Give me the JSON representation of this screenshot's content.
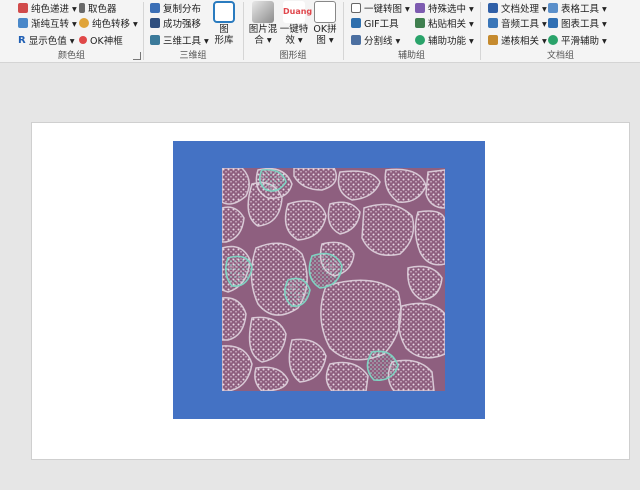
{
  "ribbon": {
    "color_group": {
      "label": "颜色组",
      "items": [
        "纯色递进 ▾",
        "渐纯互转 ▾",
        "显示色值 ▾",
        "取色器",
        "纯色转移 ▾",
        "OK神框"
      ],
      "icons": [
        "paint-bucket-icon",
        "gradient-swap-icon",
        "color-value-icon",
        "eyedropper-icon",
        "color-transfer-icon",
        "ok-frame-icon"
      ]
    },
    "3d_group": {
      "label": "三维组",
      "items": [
        "复制分布",
        "成功强移",
        "三维工具 ▾"
      ],
      "big_label": [
        "图",
        "形库"
      ],
      "icons": [
        "copy-distribute-icon",
        "layer-move-icon",
        "cube-icon",
        "shape-library-icon"
      ]
    },
    "shape_group": {
      "label": "图形组",
      "buttons": [
        {
          "lines": [
            "图片混",
            "合 ▾"
          ],
          "icon": "image-blend-icon"
        },
        {
          "lines": [
            "一键特",
            "效 ▾"
          ],
          "icon": "one-click-effect-icon"
        },
        {
          "lines": [
            "OK拼",
            "图 ▾"
          ],
          "icon": "ok-puzzle-icon"
        }
      ],
      "duang_text": "Duang"
    },
    "helper_group": {
      "label": "辅助组",
      "items": [
        "一键转图 ▾",
        "GIF工具",
        "分割线 ▾",
        "特殊选中 ▾",
        "粘贴相关 ▾",
        "辅助功能 ▾"
      ],
      "icons": [
        "convert-image-icon",
        "gif-tool-icon",
        "divider-line-icon",
        "special-select-icon",
        "paste-icon",
        "helper-icon"
      ]
    },
    "doc_group": {
      "label": "文档组",
      "items": [
        "文档处理 ▾",
        "音频工具 ▾",
        "递核相关 ▾",
        "表格工具 ▾",
        "图表工具 ▾",
        "平滑辅助 ▾"
      ],
      "icons": [
        "document-process-icon",
        "audio-tool-icon",
        "review-icon",
        "table-tool-icon",
        "chart-tool-icon",
        "smooth-helper-icon"
      ]
    }
  },
  "canvas": {
    "frame_color": "#4472c4",
    "texture_bg": "#8e5f7f",
    "texture_teal": "#7fd3c2",
    "texture_light": "#e7d8e4"
  }
}
